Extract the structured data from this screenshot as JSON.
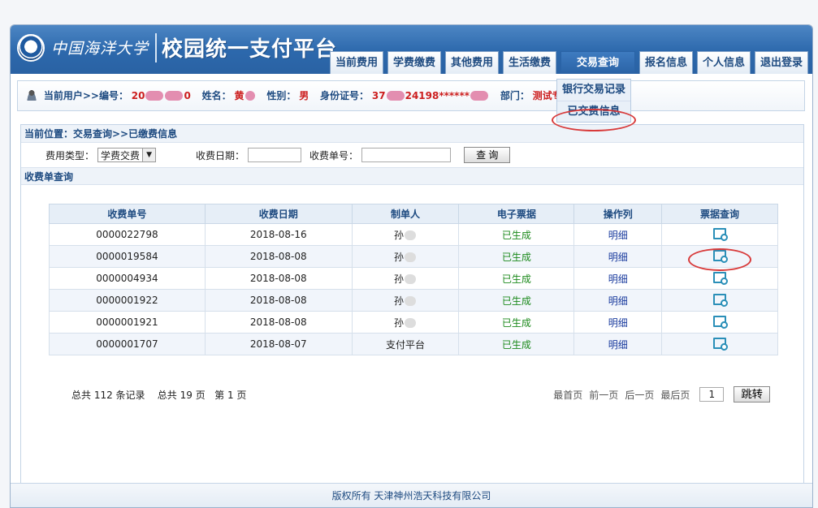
{
  "header": {
    "university": "中国海洋大学",
    "platform_title": "校园统一支付平台"
  },
  "nav": [
    {
      "label": "当前费用"
    },
    {
      "label": "学费缴费"
    },
    {
      "label": "其他费用"
    },
    {
      "label": "生活缴费"
    },
    {
      "label": "交易查询"
    },
    {
      "label": "报名信息"
    },
    {
      "label": "个人信息"
    },
    {
      "label": "退出登录"
    }
  ],
  "dropdown": [
    {
      "label": "银行交易记录"
    },
    {
      "label": "已交费信息"
    }
  ],
  "user": {
    "prefix": "当前用户>>编号：",
    "id_value": "20",
    "id_tail": "0",
    "name_label": "姓名：",
    "name_value": "黄",
    "gender_label": "性别：",
    "gender_value": "男",
    "idcard_label": "身份证号：",
    "idcard_value": "37",
    "idcard_tail": "24198******",
    "dept_label": "部门：",
    "dept_value": "测试专用"
  },
  "breadcrumb": "当前位置：交易查询>>已缴费信息",
  "filters": {
    "type_label": "费用类型：",
    "type_value": "学费交费",
    "date_label": "收费日期：",
    "number_label": "收费单号：",
    "search_button": "查 询"
  },
  "section_title": "收费单查询",
  "table": {
    "headers": [
      "收费单号",
      "收费日期",
      "制单人",
      "电子票据",
      "操作列",
      "票据查询"
    ],
    "rows": [
      {
        "no": "0000022798",
        "date": "2018-08-16",
        "maker": "孙",
        "status": "已生成",
        "op": "明细"
      },
      {
        "no": "0000019584",
        "date": "2018-08-08",
        "maker": "孙",
        "status": "已生成",
        "op": "明细"
      },
      {
        "no": "0000004934",
        "date": "2018-08-08",
        "maker": "孙",
        "status": "已生成",
        "op": "明细"
      },
      {
        "no": "0000001922",
        "date": "2018-08-08",
        "maker": "孙",
        "status": "已生成",
        "op": "明细"
      },
      {
        "no": "0000001921",
        "date": "2018-08-08",
        "maker": "孙",
        "status": "已生成",
        "op": "明细"
      },
      {
        "no": "0000001707",
        "date": "2018-08-07",
        "maker": "支付平台",
        "status": "已生成",
        "op": "明细"
      }
    ]
  },
  "pager": {
    "summary": "总共 112 条记录    总共 19 页   第 1 页",
    "first": "最首页",
    "prev": "前一页",
    "next": "后一页",
    "last": "最后页",
    "page_value": "1",
    "go": "跳转"
  },
  "footer": "版权所有 天津神州浩天科技有限公司"
}
